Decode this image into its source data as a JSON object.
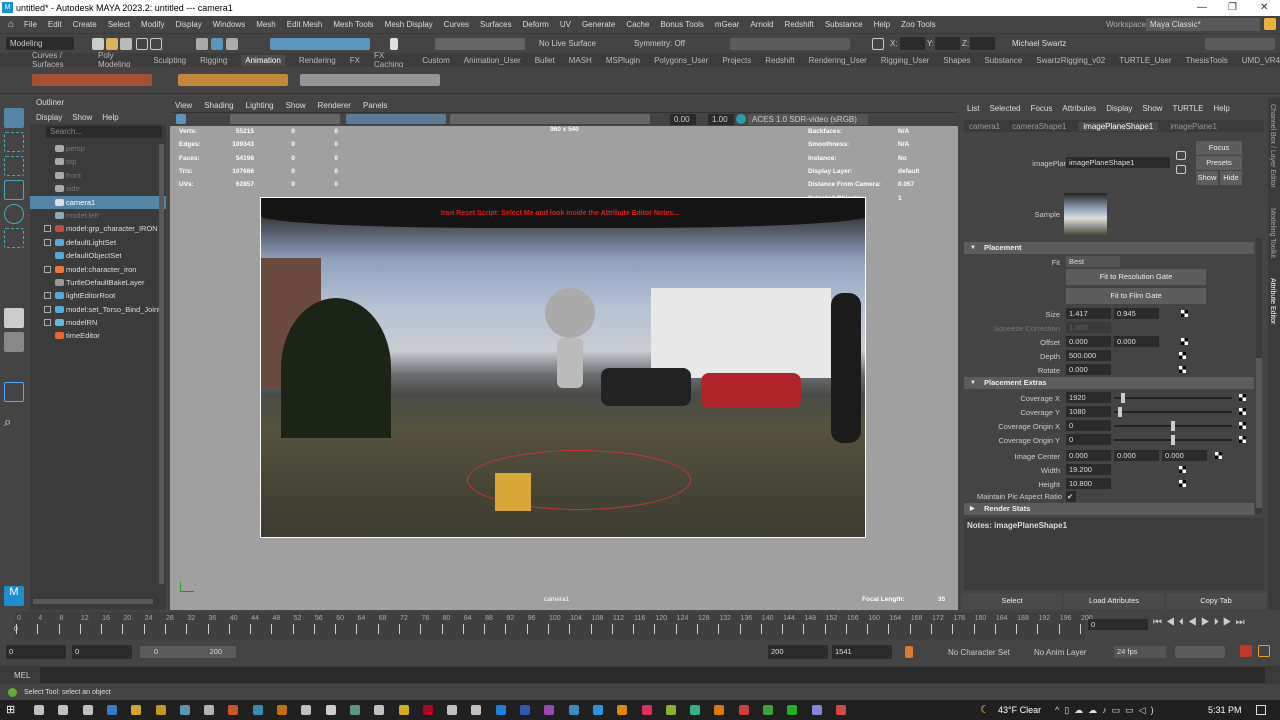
{
  "window": {
    "title": "untitled* - Autodesk MAYA 2023.2: untitled  ---  camera1",
    "logo": "M",
    "minimize": "—",
    "maximize": "❐",
    "close": "✕"
  },
  "menubar": [
    "File",
    "Edit",
    "Create",
    "Select",
    "Modify",
    "Display",
    "Windows",
    "Mesh",
    "Edit Mesh",
    "Mesh Tools",
    "Mesh Display",
    "Curves",
    "Surfaces",
    "Deform",
    "UV",
    "Generate",
    "Cache",
    "Bonus Tools",
    "mGear",
    "Arnold",
    "Redshift",
    "Substance",
    "Help",
    "Zoo Tools"
  ],
  "workspace": {
    "label": "Workspace:",
    "value": "Maya Classic*"
  },
  "statusline": {
    "menuset": "Modeling",
    "live_surface": "No Live Surface",
    "symmetry": "Symmetry: Off",
    "x": "X:",
    "y": "Y:",
    "z": "Z:",
    "user": "Michael Swartz"
  },
  "shelf_tabs": [
    "Curves / Surfaces",
    "Poly Modeling",
    "Sculpting",
    "Rigging",
    "Animation",
    "Rendering",
    "FX",
    "FX Caching",
    "Custom",
    "Animation_User",
    "Bullet",
    "MASH",
    "MSPlugin",
    "Polygons_User",
    "Projects",
    "Redshift",
    "Rendering_User",
    "Rigging_User",
    "Shapes",
    "Substance",
    "SwartzRigging_v02",
    "TURTLE_User",
    "ThesisTools",
    "UMD_VR4"
  ],
  "shelf_active": "Animation",
  "outliner": {
    "title": "Outliner",
    "menu": [
      "Display",
      "Show",
      "Help"
    ],
    "search_placeholder": "Search...",
    "items": [
      {
        "label": "persp",
        "dim": true,
        "expand": false,
        "color": "#aaa"
      },
      {
        "label": "top",
        "dim": true,
        "expand": false,
        "color": "#aaa"
      },
      {
        "label": "front",
        "dim": true,
        "expand": false,
        "color": "#aaa"
      },
      {
        "label": "side",
        "dim": true,
        "expand": false,
        "color": "#aaa"
      },
      {
        "label": "camera1",
        "sel": true,
        "expand": false,
        "color": "#ddd"
      },
      {
        "label": "model:left",
        "dim": true,
        "expand": false,
        "color": "#8ab"
      },
      {
        "label": "model:grp_character_IRON",
        "expand": true,
        "color": "#c44"
      },
      {
        "label": "defaultLightSet",
        "expand": true,
        "color": "#5ad"
      },
      {
        "label": "defaultObjectSet",
        "expand": false,
        "color": "#5ad"
      },
      {
        "label": "model:character_iron",
        "expand": true,
        "color": "#e73"
      },
      {
        "label": "TurtleDefaultBakeLayer",
        "expand": false,
        "color": "#999"
      },
      {
        "label": "lightEditorRoot",
        "expand": true,
        "color": "#5ad"
      },
      {
        "label": "model:set_Torso_Bind_Joint",
        "expand": true,
        "color": "#5ad"
      },
      {
        "label": "modelRN",
        "expand": true,
        "color": "#6bd"
      },
      {
        "label": "timeEditor",
        "expand": false,
        "color": "#e63"
      }
    ]
  },
  "viewport": {
    "menu": [
      "View",
      "Shading",
      "Lighting",
      "Show",
      "Renderer",
      "Panels"
    ],
    "exposure": "0.00",
    "gamma": "1.00",
    "colorspace": "ACES 1.0 SDR-video (sRGB)",
    "resolution": "960 x 540",
    "stats": [
      [
        "Verts:",
        "55215",
        "0",
        "0"
      ],
      [
        "Edges:",
        "109343",
        "0",
        "0"
      ],
      [
        "Faces:",
        "54198",
        "0",
        "0"
      ],
      [
        "Tris:",
        "107686",
        "0",
        "0"
      ],
      [
        "UVs:",
        "62857",
        "0",
        "0"
      ]
    ],
    "info": [
      [
        "Backfaces:",
        "N/A"
      ],
      [
        "Smoothness:",
        "N/A"
      ],
      [
        "Instance:",
        "No"
      ],
      [
        "Display Layer:",
        "default"
      ],
      [
        "Distance From Camera:",
        "0.057"
      ],
      [
        "Selected Objects:",
        "1"
      ]
    ],
    "overlay_text": "Iron Reset Script: Select Me and look inside the Attribute Editor Notes...",
    "camera_name": "camera1",
    "focal_label": "Focal Length:",
    "focal_value": "35"
  },
  "attribute_editor": {
    "menu": [
      "List",
      "Selected",
      "Focus",
      "Attributes",
      "Display",
      "Show",
      "TURTLE",
      "Help"
    ],
    "tabs": [
      "camera1",
      "cameraShape1",
      "imagePlaneShape1",
      "imagePlane1"
    ],
    "active_tab": "imagePlaneShape1",
    "node_label": "imagePlane:",
    "node_value": "imagePlaneShape1",
    "focus": "Focus",
    "presets": "Presets",
    "show": "Show",
    "hide": "Hide",
    "sample": "Sample",
    "placement": {
      "title": "Placement",
      "fit_label": "Fit",
      "fit_value": "Best",
      "fit_res": "Fit to Resolution Gate",
      "fit_film": "Fit to Film Gate",
      "size_label": "Size",
      "size": [
        "1.417",
        "0.945"
      ],
      "squeeze_label": "Squeeze Correction",
      "squeeze": "1.000",
      "offset_label": "Offset",
      "offset": [
        "0.000",
        "0.000"
      ],
      "depth_label": "Depth",
      "depth": "500.000",
      "rotate_label": "Rotate",
      "rotate": "0.000"
    },
    "extras": {
      "title": "Placement Extras",
      "coverage": [
        {
          "label": "Coverage X",
          "value": "1920",
          "slider": 0.08
        },
        {
          "label": "Coverage Y",
          "value": "1080",
          "slider": 0.05
        },
        {
          "label": "Coverage Origin X",
          "value": "0",
          "slider": 0.5
        },
        {
          "label": "Coverage Origin Y",
          "value": "0",
          "slider": 0.5
        }
      ],
      "center_label": "Image Center",
      "center": [
        "0.000",
        "0.000",
        "0.000"
      ],
      "width_label": "Width",
      "width": "19.200",
      "height_label": "Height",
      "height": "10.800",
      "aspect_label": "Maintain Pic Aspect Ratio",
      "aspect_checked": "✔"
    },
    "render_stats": "Render Stats",
    "notes": "Notes:  imagePlaneShape1",
    "bottom": [
      "Select",
      "Load Attributes",
      "Copy Tab"
    ]
  },
  "side_tabs": [
    "Channel Box / Layer Editor",
    "Modeling Toolkit",
    "Attribute Editor"
  ],
  "timeline": {
    "start": 0,
    "end": 200,
    "step": 4,
    "current": "0",
    "current_field": "0"
  },
  "range": {
    "start": "0",
    "start2": "0",
    "slider_start": "0",
    "slider_end": "200",
    "end": "200",
    "end2": "1541",
    "char_set": "No Character Set",
    "anim_layer": "No Anim Layer",
    "fps": "24 fps"
  },
  "mel": {
    "label": "MEL"
  },
  "help_line": "Select Tool: select an object",
  "taskbar": {
    "weather": "43°F  Clear",
    "time": "5:31 PM"
  }
}
